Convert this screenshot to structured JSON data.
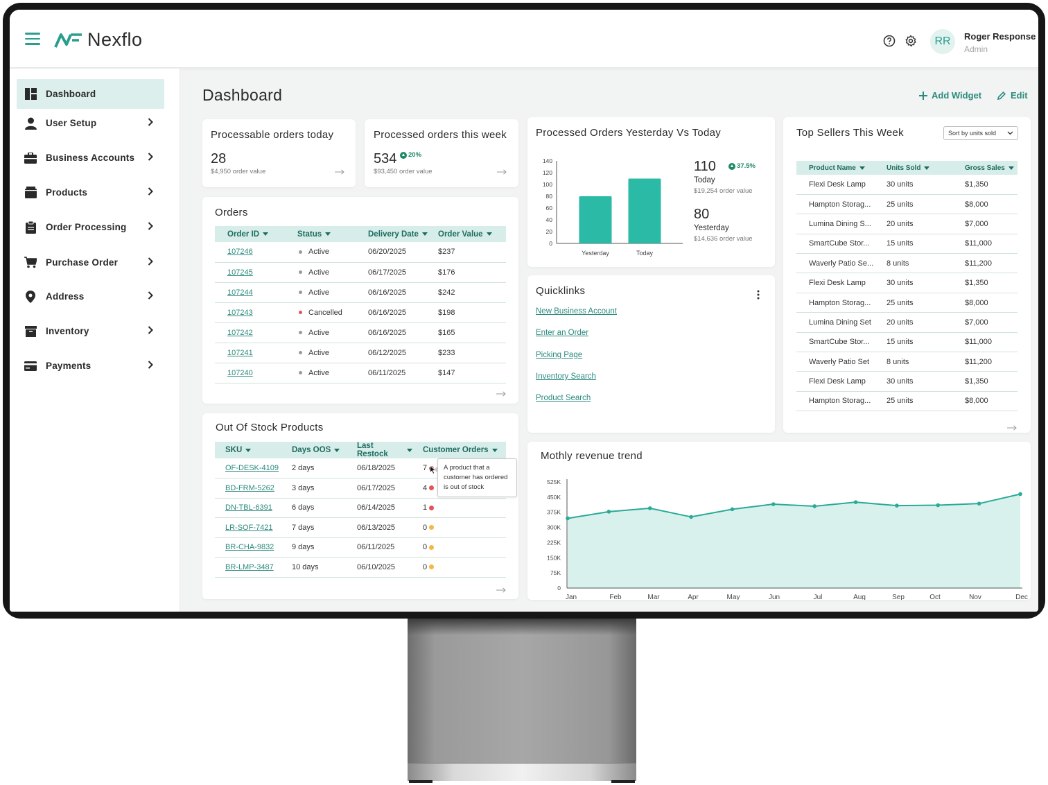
{
  "app": {
    "brand": "Nexflo",
    "user": {
      "initials": "RR",
      "name": "Roger Response",
      "role": "Admin"
    }
  },
  "sidebar": {
    "items": [
      {
        "label": "Dashboard",
        "icon": "dashboard-icon",
        "active": true
      },
      {
        "label": "User Setup",
        "icon": "user-icon"
      },
      {
        "label": "Business Accounts",
        "icon": "briefcase-icon"
      },
      {
        "label": "Products",
        "icon": "box-icon"
      },
      {
        "label": "Order Processing",
        "icon": "clipboard-icon"
      },
      {
        "label": "Purchase Order",
        "icon": "cart-icon"
      },
      {
        "label": "Address",
        "icon": "location-pin-icon"
      },
      {
        "label": "Inventory",
        "icon": "inventory-icon"
      },
      {
        "label": "Payments",
        "icon": "credit-card-icon"
      }
    ]
  },
  "page": {
    "title": "Dashboard",
    "add_widget": "Add Widget",
    "edit": "Edit"
  },
  "kpi_today": {
    "title": "Processable orders today",
    "value": "28",
    "sub": "$4,950 order value"
  },
  "kpi_week": {
    "title": "Processed orders this week",
    "value": "534",
    "change": "20%",
    "sub": "$93,450 order value"
  },
  "orders": {
    "title": "Orders",
    "columns": [
      "Order ID",
      "Status",
      "Delivery Date",
      "Order Value"
    ],
    "rows": [
      {
        "id": "107246",
        "status": "Active",
        "date": "06/20/2025",
        "value": "$237"
      },
      {
        "id": "107245",
        "status": "Active",
        "date": "06/17/2025",
        "value": "$176"
      },
      {
        "id": "107244",
        "status": "Active",
        "date": "06/16/2025",
        "value": "$242"
      },
      {
        "id": "107243",
        "status": "Cancelled",
        "date": "06/16/2025",
        "value": "$198"
      },
      {
        "id": "107242",
        "status": "Active",
        "date": "06/16/2025",
        "value": "$165"
      },
      {
        "id": "107241",
        "status": "Active",
        "date": "06/12/2025",
        "value": "$233"
      },
      {
        "id": "107240",
        "status": "Active",
        "date": "06/11/2025",
        "value": "$147"
      }
    ]
  },
  "out_of_stock": {
    "title": "Out Of Stock Products",
    "columns": [
      "SKU",
      "Days OOS",
      "Last Restock",
      "Customer Orders"
    ],
    "rows": [
      {
        "sku": "OF-DESK-4109",
        "days": "2 days",
        "restock": "06/18/2025",
        "orders": "7",
        "level": "red"
      },
      {
        "sku": "BD-FRM-5262",
        "days": "3 days",
        "restock": "06/17/2025",
        "orders": "4",
        "level": "red"
      },
      {
        "sku": "DN-TBL-6391",
        "days": "6 days",
        "restock": "06/14/2025",
        "orders": "1",
        "level": "red"
      },
      {
        "sku": "LR-SOF-7421",
        "days": "7 days",
        "restock": "06/13/2025",
        "orders": "0",
        "level": "amber"
      },
      {
        "sku": "BR-CHA-9832",
        "days": "9 days",
        "restock": "06/11/2025",
        "orders": "0",
        "level": "amber"
      },
      {
        "sku": "BR-LMP-3487",
        "days": "10 days",
        "restock": "06/10/2025",
        "orders": "0",
        "level": "amber"
      }
    ],
    "tooltip": "A product that a customer has ordered is out of stock"
  },
  "yesterday_today": {
    "title": "Processed Orders Yesterday Vs Today",
    "today_value": "110",
    "today_change": "37.5%",
    "today_label": "Today",
    "today_sub": "$19,254 order value",
    "yesterday_value": "80",
    "yesterday_label": "Yesterday",
    "yesterday_sub": "$14,636 order value"
  },
  "quicklinks": {
    "title": "Quicklinks",
    "links": [
      "New Business Account",
      "Enter an Order",
      "Picking Page",
      "Inventory Search",
      "Product Search"
    ]
  },
  "top_sellers": {
    "title": "Top Sellers This Week",
    "sort_label": "Sort by units sold",
    "columns": [
      "Product Name",
      "Units Sold",
      "Gross Sales"
    ],
    "rows": [
      {
        "name": "Flexi Desk Lamp",
        "units": "30 units",
        "sales": "$1,350"
      },
      {
        "name": "Hampton Storag...",
        "units": "25 units",
        "sales": "$8,000"
      },
      {
        "name": "Lumina Dining S...",
        "units": "20 units",
        "sales": "$7,000"
      },
      {
        "name": "SmartCube Stor...",
        "units": "15 units",
        "sales": "$11,000"
      },
      {
        "name": "Waverly Patio Se...",
        "units": "8 units",
        "sales": "$11,200"
      },
      {
        "name": "Flexi Desk Lamp",
        "units": "30 units",
        "sales": "$1,350"
      },
      {
        "name": "Hampton Storag...",
        "units": "25 units",
        "sales": "$8,000"
      },
      {
        "name": "Lumina Dining Set",
        "units": "20 units",
        "sales": "$7,000"
      },
      {
        "name": "SmartCube Stor...",
        "units": "15 units",
        "sales": "$11,000"
      },
      {
        "name": "Waverly Patio Set",
        "units": "8 units",
        "sales": "$11,200"
      },
      {
        "name": "Flexi Desk Lamp",
        "units": "30 units",
        "sales": "$1,350"
      },
      {
        "name": "Hampton Storag...",
        "units": "25 units",
        "sales": "$8,000"
      }
    ]
  },
  "revenue": {
    "title": "Mothly revenue trend"
  },
  "colors": {
    "accent": "#2a9d8f",
    "bar": "#2bbaa6",
    "status_active": "#9a9a9a",
    "status_cancelled": "#e05555",
    "level_red": "#e05555",
    "level_amber": "#f4b942",
    "area_fill": "#d9f1ec",
    "line": "#2aaa98"
  },
  "chart_data": [
    {
      "type": "bar",
      "categories": [
        "Yesterday",
        "Today"
      ],
      "values": [
        80,
        110
      ],
      "ylim": [
        0,
        140
      ],
      "yticks": [
        0,
        20,
        40,
        60,
        80,
        100,
        120,
        140
      ],
      "grid": false
    },
    {
      "type": "area",
      "x": [
        "Jan",
        "Feb",
        "Mar",
        "Apr",
        "May",
        "Jun",
        "Jul",
        "Aug",
        "Sep",
        "Oct",
        "Nov",
        "Dec"
      ],
      "values": [
        345000,
        378000,
        395000,
        352000,
        390000,
        415000,
        405000,
        425000,
        408000,
        410000,
        418000,
        465000
      ],
      "ylim": [
        0,
        525000
      ],
      "yticks": [
        "0",
        "75K",
        "150K",
        "225K",
        "300K",
        "375K",
        "450K",
        "525K"
      ],
      "grid": false
    }
  ]
}
